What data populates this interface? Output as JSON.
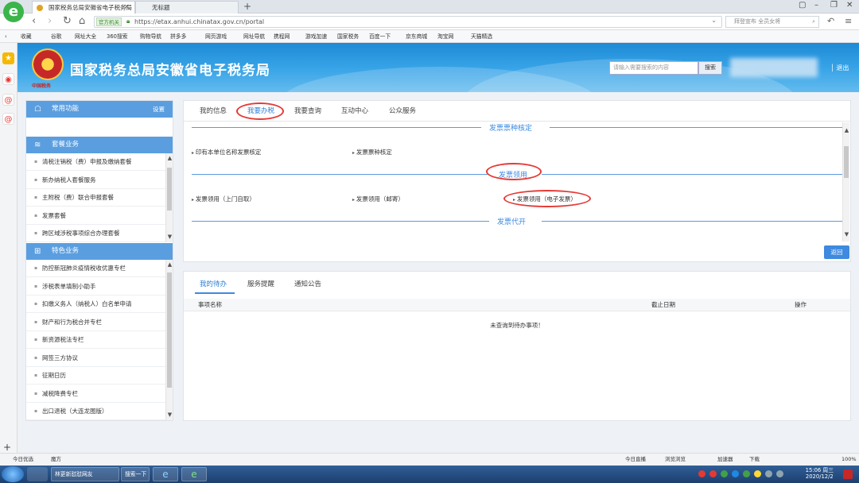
{
  "browser": {
    "tabs": [
      {
        "title": "国家税务总局安徽省电子税务局",
        "active": true
      },
      {
        "title": "无标题",
        "active": false
      }
    ],
    "new_tab_glyph": "+",
    "nav": {
      "back": "‹",
      "forward": "›",
      "refresh": "↻",
      "home": "⌂"
    },
    "url_badge": "官方机关",
    "url_text": "https://etax.anhui.chinatax.gov.cn/portal",
    "search_placeholder": "拜登宣布 全员女将",
    "bookmarks": [
      "收藏",
      "谷歌",
      "网址大全",
      "360搜索",
      "购物导航",
      "拼多多",
      "网页游戏",
      "网址导航",
      "携程网",
      "游戏加速",
      "国家税务",
      "百度一下",
      "京东商城",
      "淘宝网",
      "天猫精选"
    ]
  },
  "header": {
    "site_title": "国家税务总局安徽省电子税务局",
    "logo_caption": "中国税务",
    "search_placeholder": "请输入需要搜索的内容",
    "search_button": "搜索",
    "logout": "退出"
  },
  "left": {
    "common": {
      "title": "常用功能",
      "settings": "设置"
    },
    "package": {
      "title": "套餐业务",
      "items": [
        "清税注销税（费）申报及缴纳套餐",
        "新办纳税人套餐服务",
        "主附税（费）联合申报套餐",
        "发票套餐",
        "跨区域涉税事项综合办理套餐"
      ]
    },
    "special": {
      "title": "特色业务",
      "items": [
        "防控新冠肺炎疫情税收优惠专栏",
        "涉税表单填制小助手",
        "扣缴义务人（纳税人）白名单申请",
        "财产和行为税合并专栏",
        "新资源税法专栏",
        "网签三方协议",
        "征期日历",
        "减税降费专栏",
        "出口退税（大连龙图版）"
      ]
    }
  },
  "main": {
    "tabs": [
      "我的信息",
      "我要办税",
      "我要查询",
      "互动中心",
      "公众服务"
    ],
    "sections": [
      {
        "title": "发票票种核定",
        "links": [
          "印有本单位名称发票核定",
          "发票票种核定"
        ]
      },
      {
        "title": "发票领用",
        "links": [
          "发票领用（上门自取）",
          "发票领用（邮寄）",
          "发票领用（电子发票）"
        ]
      },
      {
        "title": "发票代开",
        "links": []
      }
    ],
    "back_button": "返回"
  },
  "bottom": {
    "tabs": [
      "我的待办",
      "服务提醒",
      "通知公告"
    ],
    "columns": [
      "事项名称",
      "截止日期",
      "操作"
    ],
    "empty_text": "未查询到待办事项！"
  },
  "statusbar": {
    "left": [
      "今日优选",
      "魔方"
    ],
    "right": [
      "今日直播",
      "浏览浏览",
      "加速器",
      "下载",
      "100%"
    ]
  },
  "taskbar": {
    "items": [
      "林更新怼怼网友",
      "搜索一下"
    ],
    "time": "15:06 周三",
    "date": "2020/12/2"
  },
  "colors": {
    "accent": "#3d8ae0",
    "annotation": "#e53935",
    "banner": "#2b95de"
  }
}
